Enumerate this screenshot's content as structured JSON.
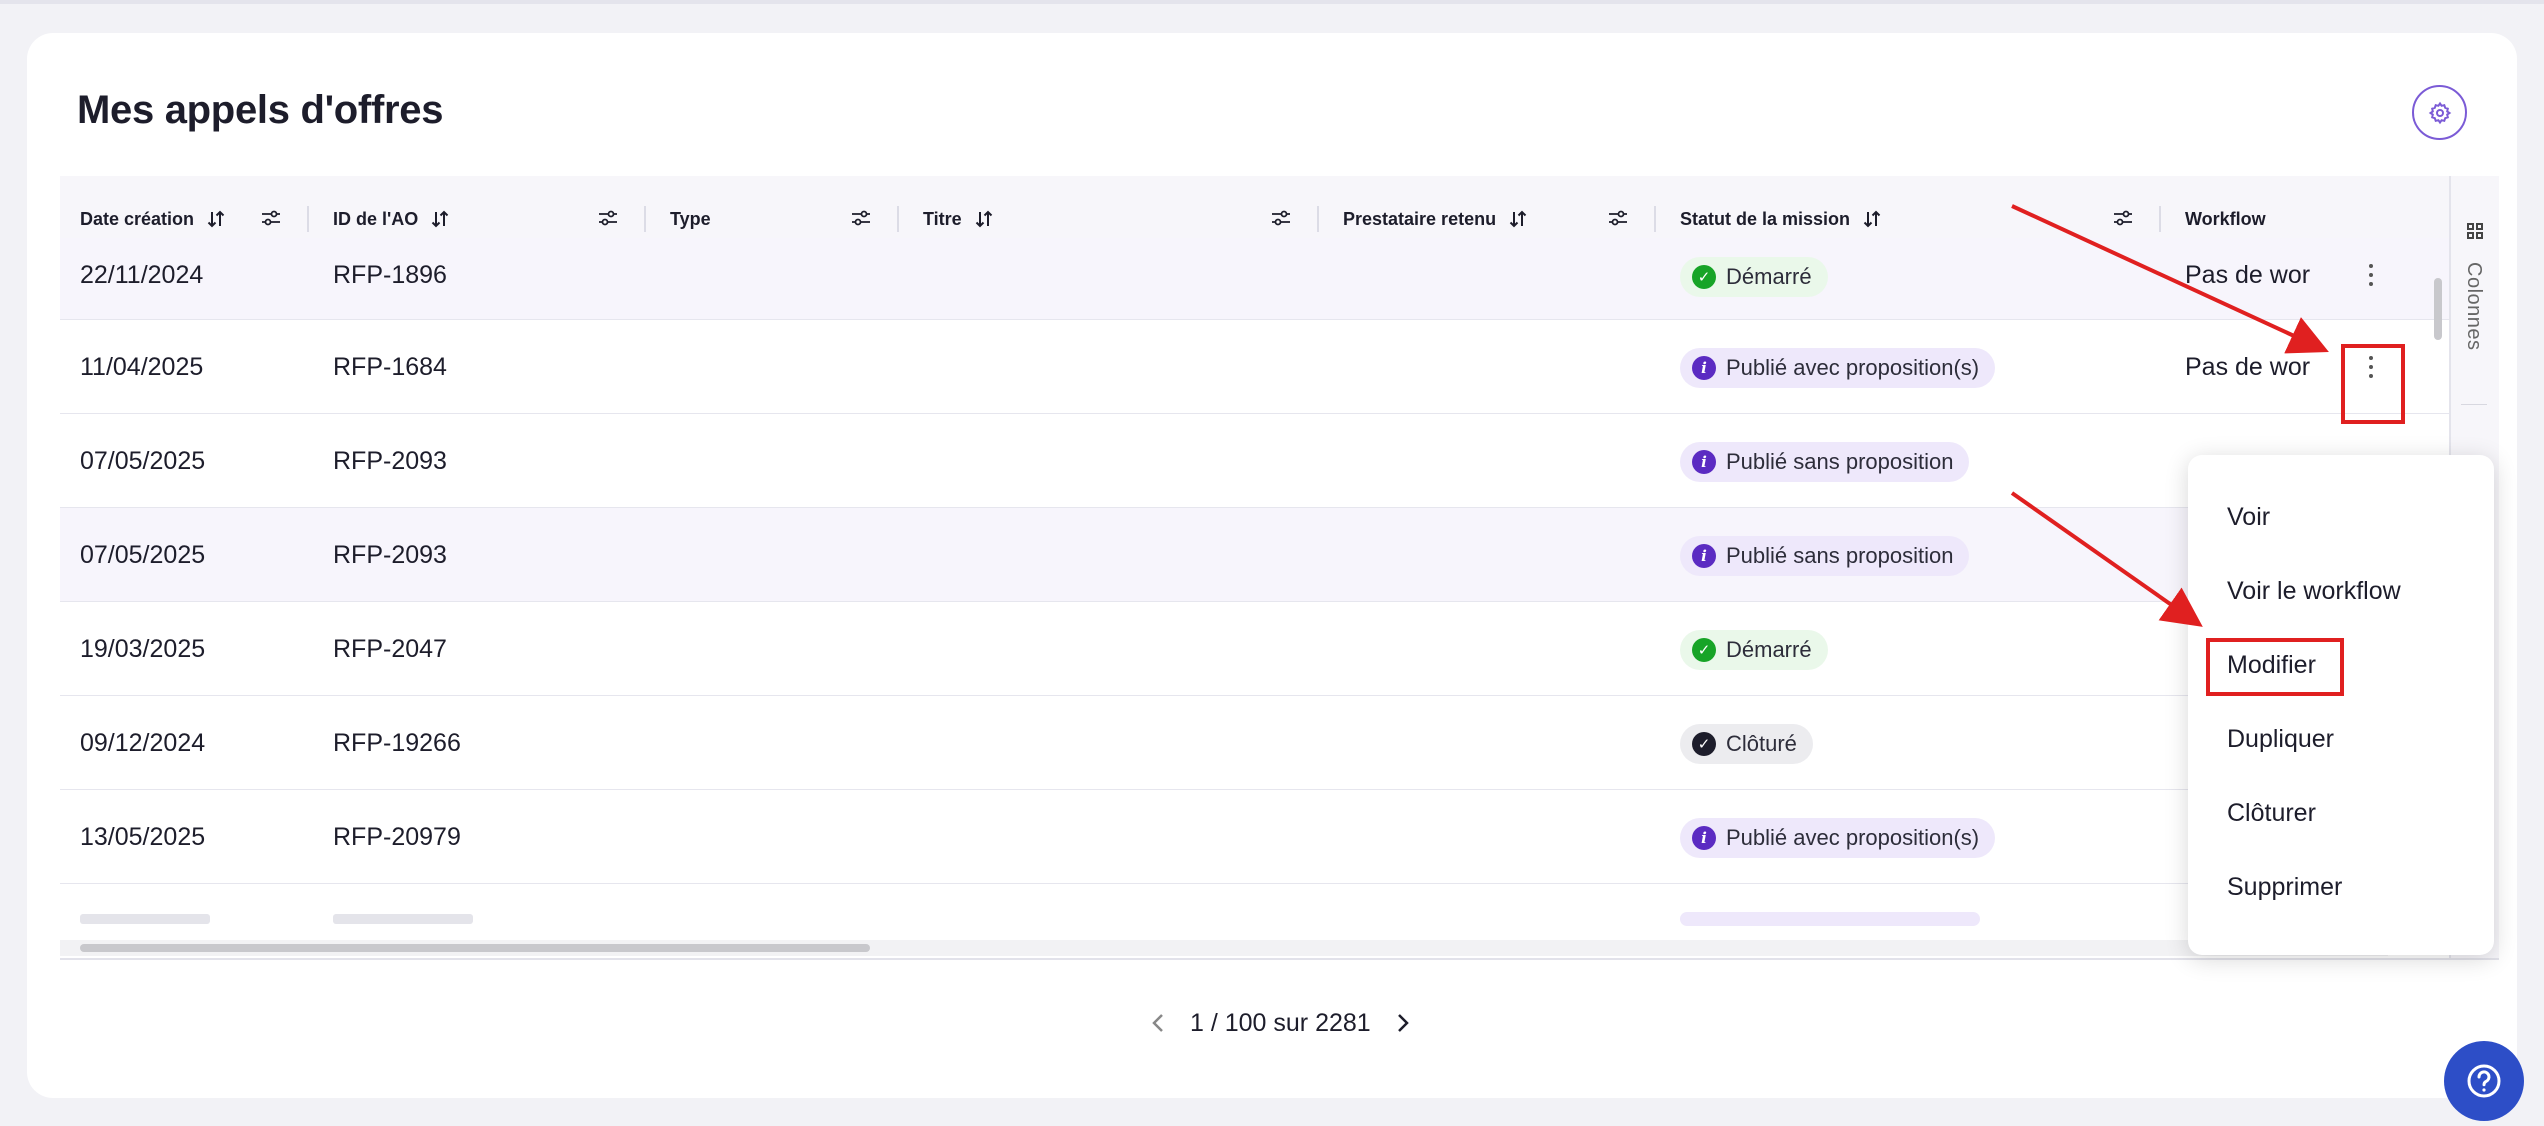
{
  "page": {
    "title": "Mes appels d'offres"
  },
  "table": {
    "columns": [
      {
        "key": "date",
        "label": "Date création",
        "sortable": true,
        "filterable": true
      },
      {
        "key": "id",
        "label": "ID de l'AO",
        "sortable": true,
        "filterable": true
      },
      {
        "key": "type",
        "label": "Type",
        "sortable": false,
        "filterable": true
      },
      {
        "key": "titre",
        "label": "Titre",
        "sortable": true,
        "filterable": true
      },
      {
        "key": "prestataire",
        "label": "Prestataire retenu",
        "sortable": true,
        "filterable": true
      },
      {
        "key": "statut",
        "label": "Statut de la mission",
        "sortable": true,
        "filterable": true
      },
      {
        "key": "workflow",
        "label": "Workflow",
        "sortable": false,
        "filterable": false
      }
    ],
    "rows": [
      {
        "date": "22/11/2024",
        "id": "RFP-1896",
        "status": "Démarré",
        "status_kind": "started",
        "workflow": "Pas de wor"
      },
      {
        "date": "11/04/2025",
        "id": "RFP-1684",
        "status": "Publié avec proposition(s)",
        "status_kind": "published",
        "workflow": "Pas de wor"
      },
      {
        "date": "07/05/2025",
        "id": "RFP-2093",
        "status": "Publié sans proposition",
        "status_kind": "published",
        "workflow": ""
      },
      {
        "date": "07/05/2025",
        "id": "RFP-2093",
        "status": "Publié sans proposition",
        "status_kind": "published",
        "workflow": ""
      },
      {
        "date": "19/03/2025",
        "id": "RFP-2047",
        "status": "Démarré",
        "status_kind": "started",
        "workflow": ""
      },
      {
        "date": "09/12/2024",
        "id": "RFP-19266",
        "status": "Clôturé",
        "status_kind": "closed",
        "workflow": ""
      },
      {
        "date": "13/05/2025",
        "id": "RFP-20979",
        "status": "Publié avec proposition(s)",
        "status_kind": "published",
        "workflow": ""
      }
    ]
  },
  "side_panel": {
    "label": "Colonnes",
    "icon": "columns-grid-icon"
  },
  "context_menu": {
    "items": [
      "Voir",
      "Voir le workflow",
      "Modifier",
      "Dupliquer",
      "Clôturer",
      "Supprimer"
    ],
    "highlighted": "Modifier"
  },
  "pagination": {
    "text": "1 / 100 sur 2281",
    "prev_icon": "chevron-left-icon",
    "next_icon": "chevron-right-icon"
  },
  "icons": {
    "settings": "gear-icon",
    "help": "help-icon",
    "sort": "sort-arrows-icon",
    "filter": "sliders-icon",
    "row_actions": "kebab-menu-icon"
  },
  "colors": {
    "accent": "#7b5bd6",
    "started": "#17a427",
    "published": "#5b2bc2",
    "closed": "#1d1d2b",
    "annotation": "#e02020",
    "help_button": "#2d4ec7"
  }
}
